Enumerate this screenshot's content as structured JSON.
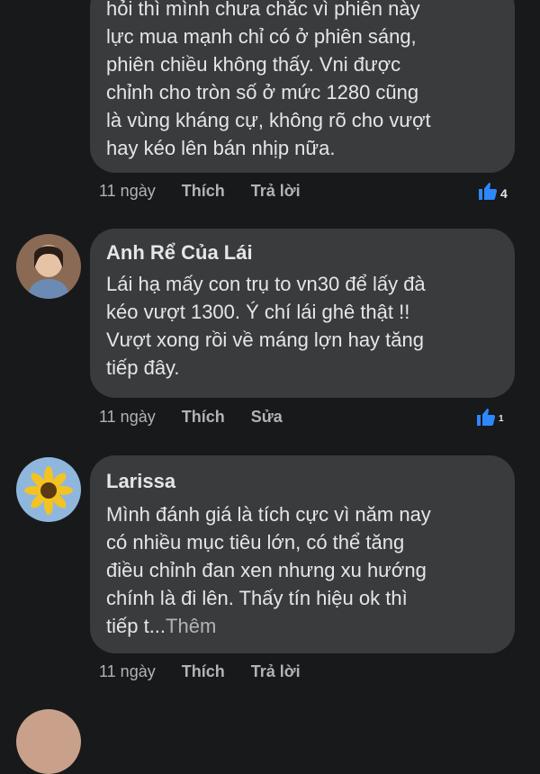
{
  "comments": [
    {
      "lines": [
        "hỏi thì mình chưa chắc vì phiên này",
        "lực mua mạnh chỉ có ở phiên sáng,",
        "phiên chiều không thấy. Vni được",
        "chỉnh cho tròn số ở mức 1280 cũng",
        "là vùng kháng cự, không rõ cho vượt",
        "hay kéo lên bán nhịp nữa."
      ],
      "time": "11 ngày",
      "like_label": "Thích",
      "action_label": "Trả lời",
      "reactions": "4",
      "icon": "thumbs-up-icon"
    },
    {
      "author": "Anh Rể Của Lái",
      "lines": [
        "Lái hạ mấy con trụ to vn30 để lấy đà",
        "kéo vượt 1300. Ý chí lái ghê thật  !!",
        "Vượt xong rồi về máng lợn hay tăng",
        "tiếp đây."
      ],
      "time": "11 ngày",
      "like_label": "Thích",
      "action_label": "Sửa",
      "reactions": "1",
      "icon": "thumbs-up-icon"
    },
    {
      "author": "Larissa",
      "lines": [
        "Mình đánh giá là tích cực vì năm nay",
        "có nhiều mục tiêu lớn, có thể tăng",
        "điều chỉnh đan xen nhưng xu hướng",
        "chính là đi lên. Thấy tín hiệu ok thì"
      ],
      "last_line": "tiếp t...",
      "more_label": "Thêm",
      "time": "11 ngày",
      "like_label": "Thích",
      "action_label": "Trả lời"
    }
  ]
}
